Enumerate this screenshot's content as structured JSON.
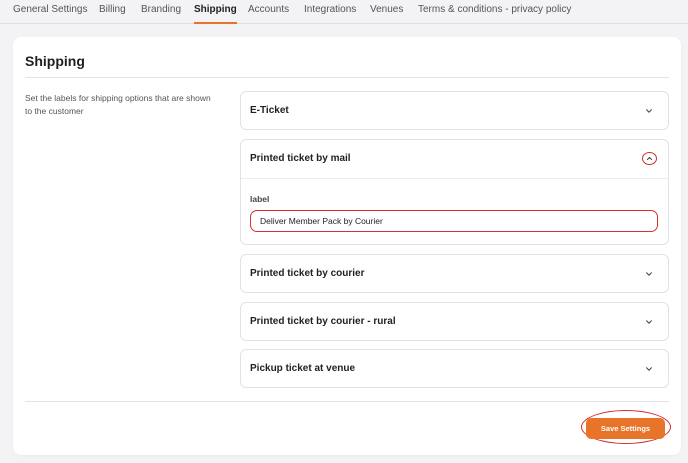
{
  "tabs": [
    {
      "label": "General Settings",
      "active": false
    },
    {
      "label": "Billing",
      "active": false
    },
    {
      "label": "Branding",
      "active": false
    },
    {
      "label": "Shipping",
      "active": true
    },
    {
      "label": "Accounts",
      "active": false
    },
    {
      "label": "Integrations",
      "active": false
    },
    {
      "label": "Venues",
      "active": false
    },
    {
      "label": "Terms & conditions - privacy policy",
      "active": false
    }
  ],
  "section": {
    "title": "Shipping",
    "description": "Set the labels for shipping options that are shown to the customer"
  },
  "shipping_options": [
    {
      "title": "E-Ticket",
      "expanded": false
    },
    {
      "title": "Printed ticket by mail",
      "expanded": true,
      "field_label": "label",
      "field_value": "Deliver Member Pack by Courier"
    },
    {
      "title": "Printed ticket by courier",
      "expanded": false
    },
    {
      "title": "Printed ticket by courier - rural",
      "expanded": false
    },
    {
      "title": "Pickup ticket at venue",
      "expanded": false
    }
  ],
  "actions": {
    "save_label": "Save Settings"
  },
  "colors": {
    "accent": "#e8742a",
    "highlight": "#d62c2c",
    "background": "#f3f3f5"
  },
  "icons": {
    "collapsed": "chevron-down-icon",
    "expanded": "chevron-up-icon"
  }
}
